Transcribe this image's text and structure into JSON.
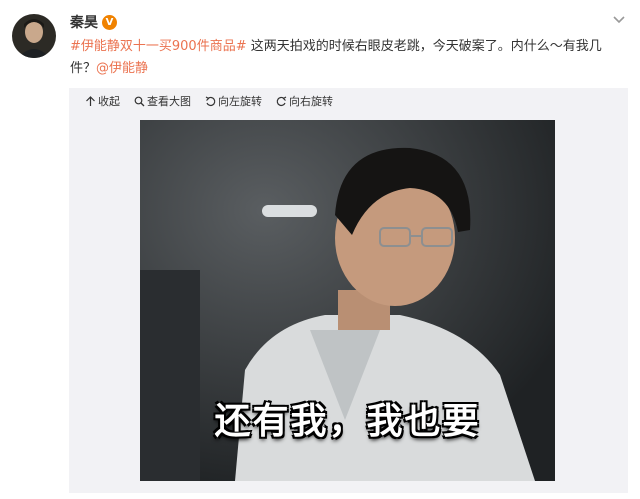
{
  "post": {
    "author": "秦昊",
    "vip_badge": "V",
    "text_segments": [
      {
        "type": "topic",
        "text": "#伊能静双十一买900件商品#"
      },
      {
        "type": "text",
        "text": " 这两天拍戏的时候右眼皮老跳，今天破案了。内什么～有我几件？"
      },
      {
        "type": "mention",
        "text": "@伊能静"
      }
    ]
  },
  "toolbar": {
    "collapse": "收起",
    "view_large": "查看大图",
    "rotate_left": "向左旋转",
    "rotate_right": "向右旋转"
  },
  "image": {
    "caption": "还有我，我也要"
  }
}
